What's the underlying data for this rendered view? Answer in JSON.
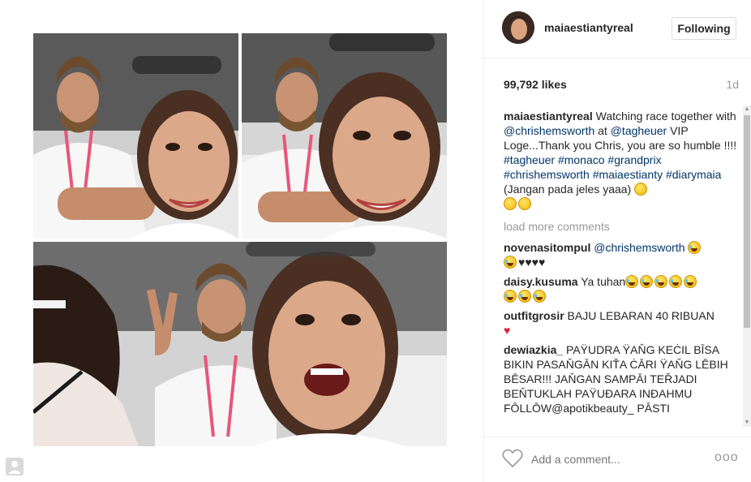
{
  "post": {
    "username": "maiaestiantyreal",
    "follow_label": "Following",
    "likes": "99,792 likes",
    "time": "1d"
  },
  "caption": {
    "user": "maiaestiantyreal",
    "text1": " Watching race together with ",
    "tag1": "@chrishemsworth",
    "text2": " at ",
    "tag2": "@tagheuer",
    "text3": " VIP Loge...Thank you Chris, you are so humble !!!! ",
    "hashtags": "#tagheuer #monaco #grandprix #chrishemsworth #maiaestianty #diarymaia",
    "text4": " (Jangan pada jeles yaaa) "
  },
  "load_more": "load more comments",
  "comments": [
    {
      "user": "novenasitompul",
      "tag": "@chrishemsworth",
      "text": ""
    },
    {
      "user": "daisy.kusuma",
      "tag": "",
      "text": "Ya tuhan"
    },
    {
      "user": "outfitgrosir",
      "tag": "",
      "text": "BAJU LEBARAN 40 RIBUAN"
    },
    {
      "user": "dewiazkia_",
      "tag": "",
      "text": "PAYUDRA YANG KECIL BISA BIKIN PASANGAN KITA CARI YANG LEBIH BESAR!!! JANGAN SAMPAI TERJADI BENTUKLAH PAYUDARA INDAHMU FOLLOW@apotikbeauty_ PASTI"
    }
  ],
  "dewiazkia_display": "PAŸUDRA ŸAŇG KEĊIL BĪSA BIKIN PASAŇGĀN KIŤA ĊĀRI ŸAŇG LĒBIH BĒSAR!!! JAŇGAN SAMPĀI TEŘJADI BEŇTUKLAH PAŸUĐARA INĐAHMU FŌLLŌW@apotikbeauty_ PĀSTI",
  "footer": {
    "add_comment_placeholder": "Add a comment...",
    "more_label": "ooo"
  },
  "icons": {
    "like": "heart-outline-icon",
    "more": "more-options-icon",
    "corner": "profile-placeholder-icon"
  },
  "colors": {
    "link": "#003569",
    "muted": "#999999",
    "border": "#efefef",
    "heart_red": "#e0243a"
  }
}
